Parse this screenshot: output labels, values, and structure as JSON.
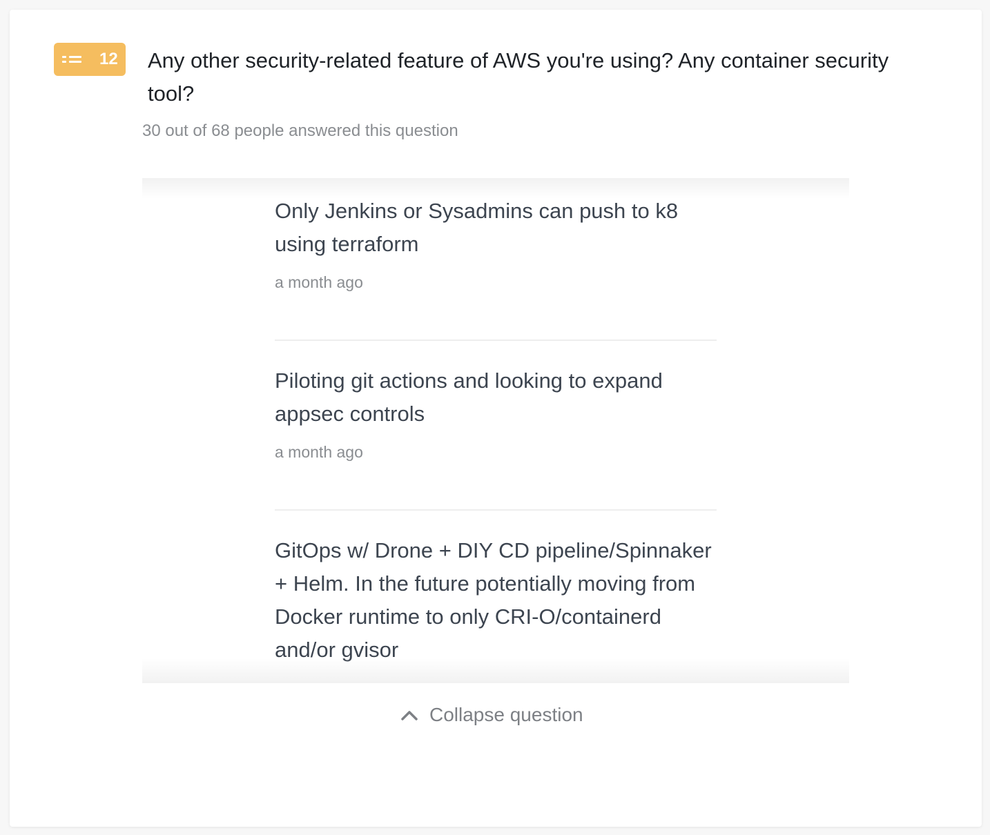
{
  "question": {
    "number": "12",
    "icon": "list-icon",
    "title": "Any other security-related feature of AWS you're using? Any container security tool?",
    "answered_summary": "30 out of 68 people answered this question"
  },
  "answers": [
    {
      "text": "Only Jenkins or Sysadmins can push to k8 using terraform",
      "time": "a month ago"
    },
    {
      "text": "Piloting git actions and looking to expand appsec controls",
      "time": "a month ago"
    },
    {
      "text": "GitOps w/ Drone + DIY CD pipeline/Spinnaker + Helm. In the future potentially moving from Docker runtime to only CRI-O/containerd and/or gvisor",
      "time": ""
    }
  ],
  "collapse": {
    "label": "Collapse question",
    "icon": "chevron-up-icon"
  },
  "colors": {
    "badge": "#f5bd5f",
    "title": "#1f2328",
    "answer_text": "#3d4550",
    "muted": "#8a8d91"
  }
}
